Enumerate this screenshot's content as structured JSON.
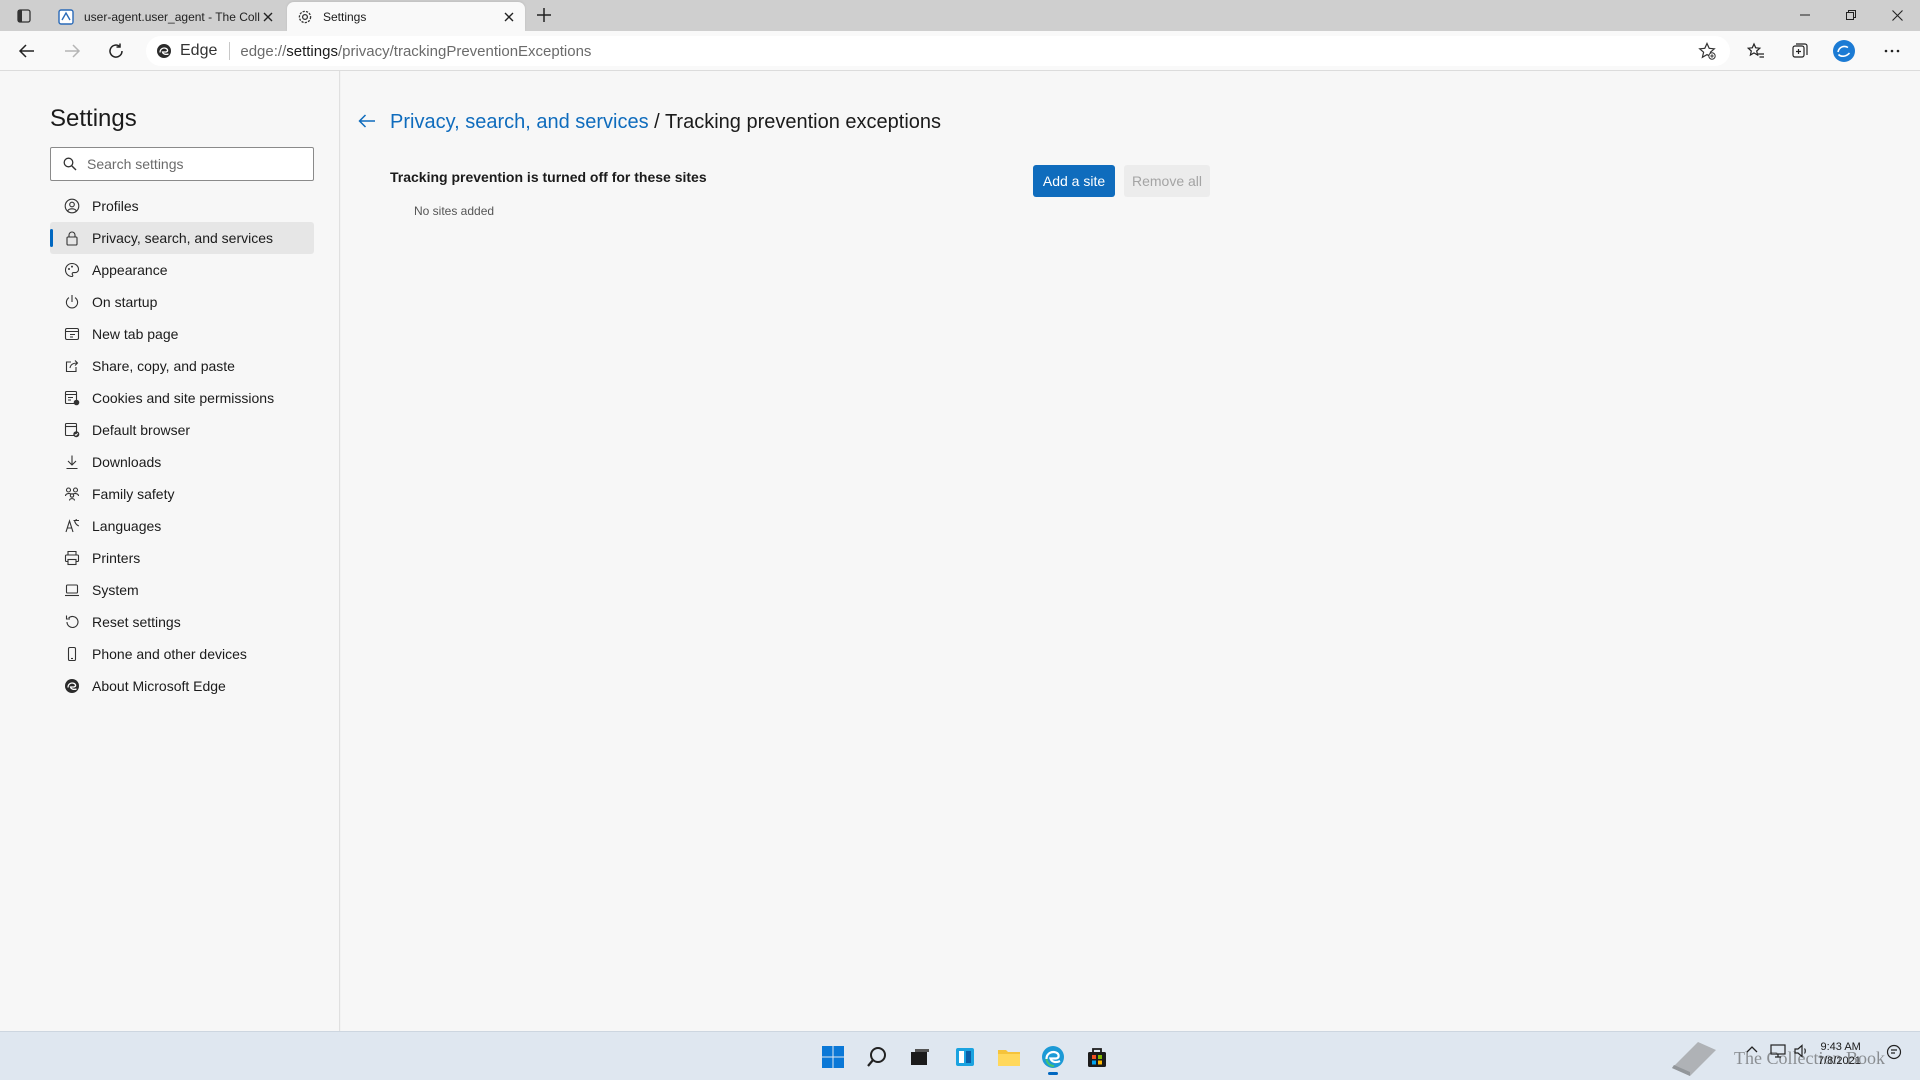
{
  "browser": {
    "tabs": [
      {
        "title": "user-agent.user_agent - The Coll",
        "active": false
      },
      {
        "title": "Settings",
        "active": true
      }
    ],
    "address": {
      "site_label": "Edge",
      "url_prefix": "edge://",
      "url_host": "settings",
      "url_path": "/privacy/trackingPreventionExceptions"
    }
  },
  "sidebar": {
    "title": "Settings",
    "search_placeholder": "Search settings",
    "items": [
      {
        "label": "Profiles",
        "icon": "profile-icon"
      },
      {
        "label": "Privacy, search, and services",
        "icon": "lock-icon",
        "selected": true
      },
      {
        "label": "Appearance",
        "icon": "palette-icon"
      },
      {
        "label": "On startup",
        "icon": "power-icon"
      },
      {
        "label": "New tab page",
        "icon": "new-tab-icon"
      },
      {
        "label": "Share, copy, and paste",
        "icon": "share-icon"
      },
      {
        "label": "Cookies and site permissions",
        "icon": "cookies-icon"
      },
      {
        "label": "Default browser",
        "icon": "default-browser-icon"
      },
      {
        "label": "Downloads",
        "icon": "download-icon"
      },
      {
        "label": "Family safety",
        "icon": "family-icon"
      },
      {
        "label": "Languages",
        "icon": "languages-icon"
      },
      {
        "label": "Printers",
        "icon": "printer-icon"
      },
      {
        "label": "System",
        "icon": "system-icon"
      },
      {
        "label": "Reset settings",
        "icon": "reset-icon"
      },
      {
        "label": "Phone and other devices",
        "icon": "phone-icon"
      },
      {
        "label": "About Microsoft Edge",
        "icon": "edge-icon"
      }
    ]
  },
  "main": {
    "breadcrumb_parent": "Privacy, search, and services",
    "breadcrumb_sep": " / ",
    "breadcrumb_current": "Tracking prevention exceptions",
    "section_title": "Tracking prevention is turned off for these sites",
    "empty_text": "No sites added",
    "add_button": "Add a site",
    "remove_button": "Remove all"
  },
  "taskbar": {
    "time": "9:43 AM",
    "date": "7/8/2021",
    "watermark": "The Collection Book"
  },
  "colors": {
    "accent": "#0f6cbd",
    "selected_bar": "#0067c0"
  }
}
